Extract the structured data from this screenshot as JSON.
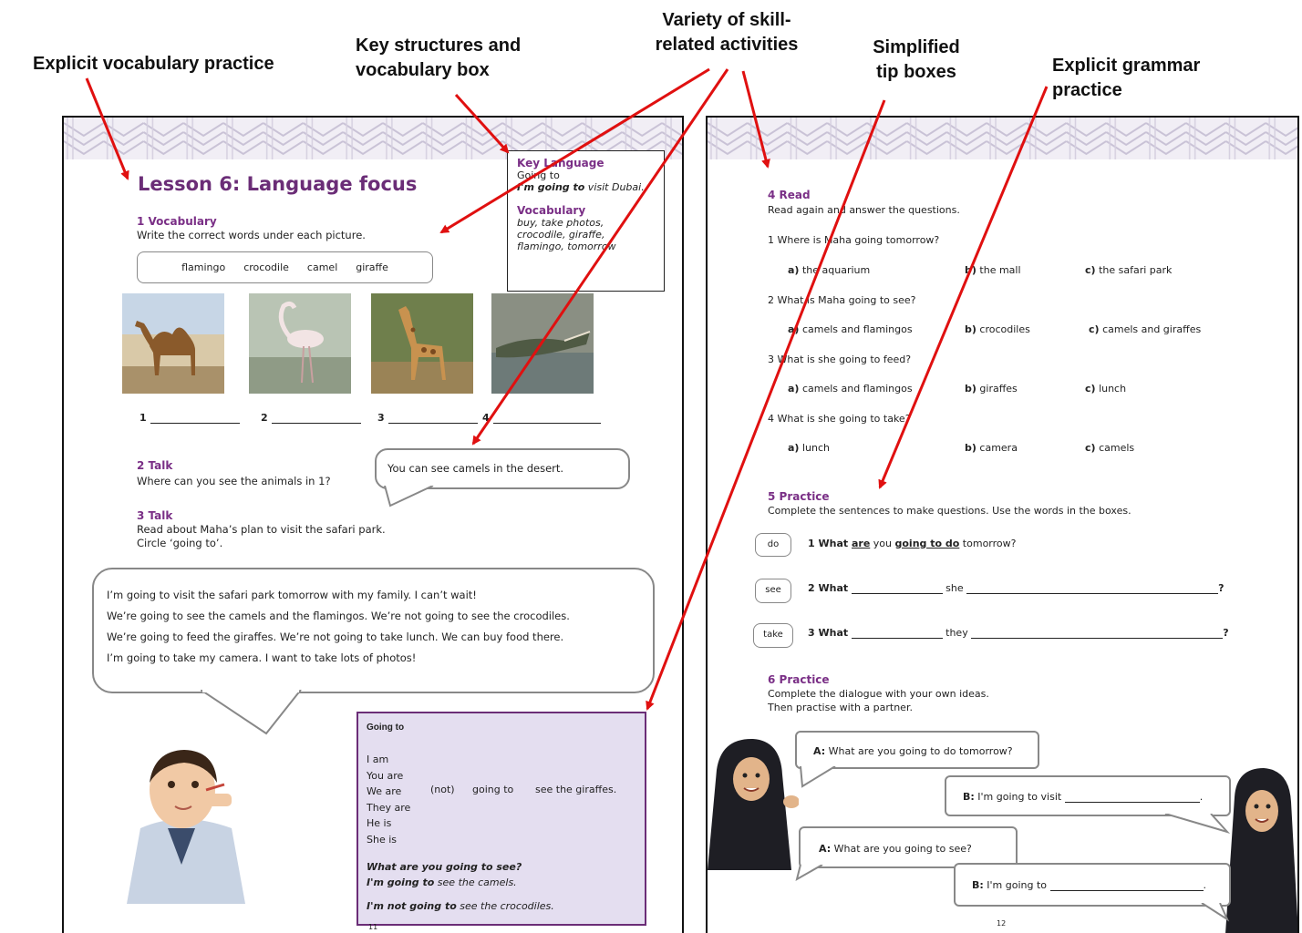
{
  "callouts": {
    "vocab_practice": "Explicit vocabulary practice",
    "key_structures": [
      "Key structures and",
      "vocabulary box"
    ],
    "variety": [
      "Variety of skill-",
      "related activities"
    ],
    "tip_boxes": [
      "Simplified",
      "tip boxes"
    ],
    "grammar_practice": [
      "Explicit grammar",
      "practice"
    ]
  },
  "left_page": {
    "title": "Lesson 6: Language focus",
    "key_box": {
      "kl_heading": "Key Language",
      "kl_line1": "Going to",
      "kl_line2_bold": "I'm going to",
      "kl_line2_rest": " visit Dubai.",
      "vocab_heading": "Vocabulary",
      "vocab_lines": [
        "buy, take photos,",
        "crocodile, giraffe,",
        "flamingo, tomorrow"
      ]
    },
    "s1_title": "1 Vocabulary",
    "s1_instr": "Write the correct words under each picture.",
    "words": [
      "flamingo",
      "crocodile",
      "camel",
      "giraffe"
    ],
    "numbers": [
      "1",
      "2",
      "3",
      "4"
    ],
    "s2_title": "2 Talk",
    "s2_instr": "Where can you see the animals in 1?",
    "s2_bubble": "You can see camels in the desert.",
    "s3_title": "3 Talk",
    "s3_instr1": "Read about Maha’s plan to visit the safari park.",
    "s3_instr2": "Circle ‘going to’.",
    "story": [
      "I’m going to visit the safari park tomorrow with my family. I can’t wait!",
      "We’re going to see the camels and the flamingos. We’re not going to see the crocodiles.",
      "We’re going to feed the giraffes. We’re not going to take lunch. We can buy food there.",
      "I’m going to take my camera. I want to take lots of photos!"
    ],
    "tip": {
      "heading": "Going to",
      "subjects": [
        "I am",
        "You are",
        "We are",
        "They are",
        "He is",
        "She is"
      ],
      "not": "(not)",
      "going_to": "going to",
      "see_giraffes": "see the giraffes.",
      "q_bold": "What are you going to see?",
      "a1_bold": "I'm going to",
      "a1_rest": " see the camels.",
      "a2_bold": "I'm not going to",
      "a2_rest": " see the crocodiles."
    },
    "page_num": "11"
  },
  "right_page": {
    "s4_title": "4 Read",
    "s4_instr": "Read again and answer the questions.",
    "questions": [
      {
        "q": "1 Where is Maha going tomorrow?",
        "opts": [
          [
            "a)",
            "the aquarium"
          ],
          [
            "b)",
            "the mall"
          ],
          [
            "c)",
            "the safari park"
          ]
        ]
      },
      {
        "q": "2 What is Maha going to see?",
        "opts": [
          [
            "a)",
            "camels and flamingos"
          ],
          [
            "b)",
            "crocodiles"
          ],
          [
            "c)",
            "camels and giraffes"
          ]
        ]
      },
      {
        "q": "3 What is she going to feed?",
        "opts": [
          [
            "a)",
            "camels and flamingos"
          ],
          [
            "b)",
            "giraffes"
          ],
          [
            "c)",
            "lunch"
          ]
        ]
      },
      {
        "q": "4 What is she going to take?",
        "opts": [
          [
            "a)",
            "lunch"
          ],
          [
            "b)",
            "camera"
          ],
          [
            "c)",
            "camels"
          ]
        ]
      }
    ],
    "s5_title": "5 Practice",
    "s5_instr": "Complete the sentences to make questions. Use the words in the boxes.",
    "p5": {
      "box1": "do",
      "box2": "see",
      "box3": "take",
      "l1_pre": "1 What ",
      "l1_are": "are",
      "l1_mid": " you ",
      "l1_gt": "going to do",
      "l1_post": " tomorrow?",
      "l2_pre": "2 What",
      "l2_mid": "she",
      "l2_end": "?",
      "l3_pre": "3 What",
      "l3_mid": "they",
      "l3_end": "?"
    },
    "s6_title": "6 Practice",
    "s6_instr1": "Complete the dialogue with your own ideas.",
    "s6_instr2": "Then practise with a partner.",
    "dialog": [
      {
        "who": "A:",
        "text": " What are you going to do tomorrow?"
      },
      {
        "who": "B:",
        "text": " I'm going to visit"
      },
      {
        "who": "A:",
        "text": " What are you going to see?"
      },
      {
        "who": "B:",
        "text": " I'm going to"
      }
    ],
    "page_num": "12"
  },
  "colors": {
    "accent": "#7a2f86",
    "arrow": "#e01010",
    "tip_bg": "#e4def0",
    "tip_border": "#6b2d77"
  }
}
